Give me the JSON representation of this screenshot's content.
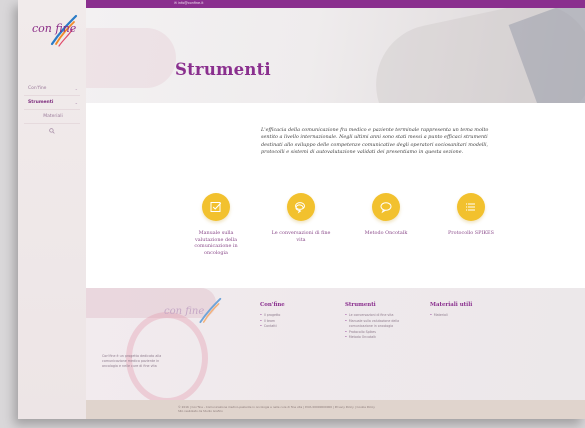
{
  "topbar": {
    "email": "info@conﬁne.it"
  },
  "sidebar": {
    "logo_text": "con fine",
    "nav": [
      {
        "label": "Con'fine",
        "has_chevron": true
      },
      {
        "label": "Strumenti",
        "has_chevron": true,
        "active": true
      },
      {
        "label": "Materiali",
        "has_chevron": false
      }
    ]
  },
  "hero": {
    "title": "Strumenti"
  },
  "intro": {
    "text": "L'efficacia della comunicazione fra medico e paziente terminale rappresenta un tema molto sentito a livello internazionale. Negli ultimi anni sono stati messi a punto efficaci strumenti destinati allo sviluppo delle competenze comunicative degli operatori sociosanitari modelli, protocolli e sistemi di autovalutazione validati dei presentiamo in questa sezione."
  },
  "tools": [
    {
      "icon": "checklist-icon",
      "label": "Manuale sulla valutazione della comunicazione in oncologia"
    },
    {
      "icon": "chat-bubbles-icon",
      "label": "Le conversazioni di fine vita"
    },
    {
      "icon": "speech-bubble-icon",
      "label": "Metodo Oncotalk"
    },
    {
      "icon": "list-icon",
      "label": "Protocollo SPIKES"
    }
  ],
  "footer": {
    "logo_text": "con fine",
    "tagline": "Con'fine è un progetto dedicato alla comunicazione medico paziente in oncologia e nelle cure di fine vita",
    "columns": [
      {
        "title": "Con'fine",
        "links": [
          "Il progetto",
          "Il team",
          "Contatti"
        ]
      },
      {
        "title": "Strumenti",
        "links": [
          "Le conversazioni di fine vita",
          "Manuale sulla valutazione della comunicazione in oncologia",
          "Protocollo Spikes",
          "Metodo Oncotalk"
        ]
      },
      {
        "title": "Materiali utili",
        "links": [
          "Materiali"
        ]
      }
    ],
    "bottom_line1": "© 2016 | Con'fine - Comunicazione medico-paziente in oncologia e nelle cure di fine vita | P.IVA 00000000000 | Privacy Policy | Cookie Policy",
    "bottom_line2": "Sito realizzato da Studio Grafico"
  },
  "colors": {
    "brand": "#8a2f8e",
    "accent": "#f2c12e"
  }
}
